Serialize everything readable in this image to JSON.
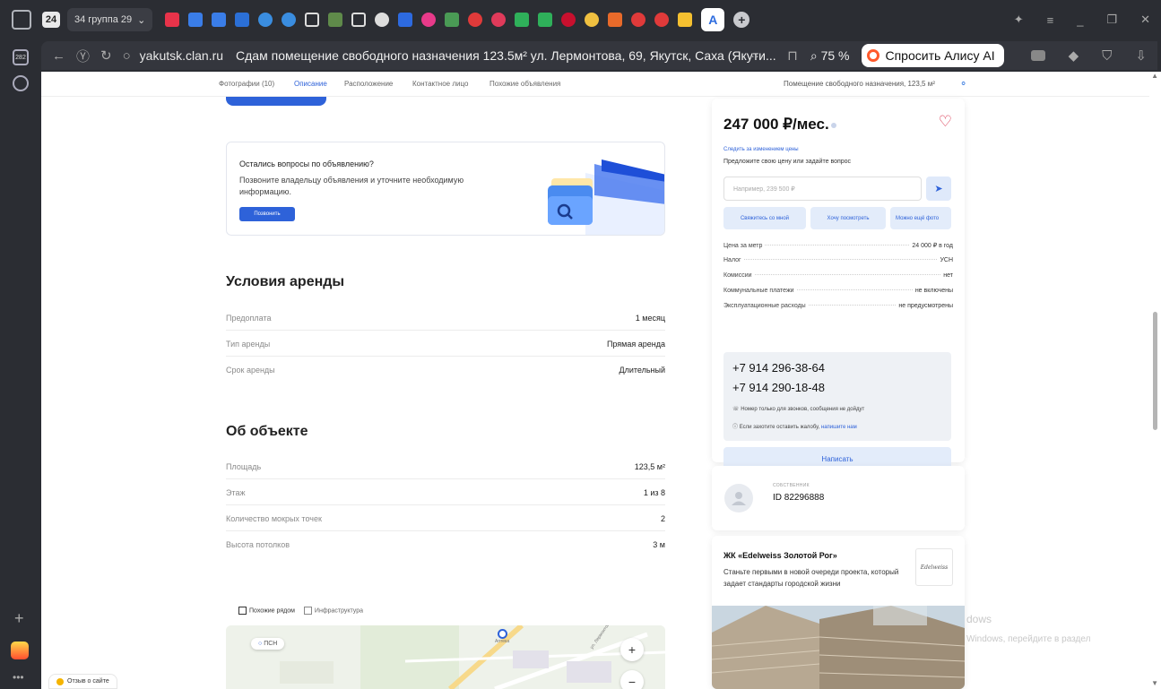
{
  "browser": {
    "tab_count": "24",
    "tab_group": "34 группа 29",
    "active_tab_letter": "A",
    "url": "yakutsk.clan.ru",
    "page_title": "Сдам помещение свободного назначения 123.5м² ул. Лермонтова, 69, Якутск, Саха (Якути...",
    "zoom": "75 %",
    "alice_label": "Спросить Алису AI",
    "side_badge": "282"
  },
  "nav": {
    "items": [
      "Фотографии (10)",
      "Описание",
      "Расположение",
      "Контактное лицо",
      "Похожие объявления"
    ],
    "active_index": 1,
    "right_title": "Помещение свободного назначения, 123,5 м²"
  },
  "question": {
    "title": "Остались вопросы по объявлению?",
    "text": "Позвоните владельцу объявления и уточните необходимую информацию.",
    "button": "Позвонить"
  },
  "rent_terms": {
    "heading": "Условия аренды",
    "rows": [
      {
        "label": "Предоплата",
        "value": "1 месяц"
      },
      {
        "label": "Тип аренды",
        "value": "Прямая аренда"
      },
      {
        "label": "Срок аренды",
        "value": "Длительный"
      }
    ]
  },
  "object": {
    "heading": "Об объекте",
    "rows": [
      {
        "label": "Площадь",
        "value": "123,5 м²"
      },
      {
        "label": "Этаж",
        "value": "1 из 8"
      },
      {
        "label": "Количество мокрых точек",
        "value": "2"
      },
      {
        "label": "Высота потолков",
        "value": "3 м"
      }
    ]
  },
  "map": {
    "tabs": [
      "Похожие рядом",
      "Инфраструктура"
    ],
    "pill": "ПСН",
    "poi_label": "Аптека",
    "street": "ул. Лермонтова",
    "zoom_in": "+",
    "zoom_out": "−"
  },
  "feedback": "Отзыв о сайте",
  "price_card": {
    "price": "247 000 ₽/мес.",
    "watch_link": "Следить за изменением цены",
    "offer_text": "Предложите свою цену или задайте вопрос",
    "offer_placeholder": "Например, 239 500 ₽",
    "chips": [
      "Свяжитесь со мной",
      "Хочу посмотреть",
      "Можно ещё фото"
    ],
    "specs": [
      {
        "label": "Цена за метр",
        "value": "24 000 ₽ в год"
      },
      {
        "label": "Налог",
        "value": "УСН"
      },
      {
        "label": "Комиссии",
        "value": "нет"
      },
      {
        "label": "Коммунальные платежи",
        "value": "не включены"
      },
      {
        "label": "Эксплуатационные расходы",
        "value": "не предусмотрены"
      }
    ],
    "phones": [
      "+7 914 296-38-64",
      "+7 914 290-18-48"
    ],
    "note_calls": "Номер только для звонков, сообщения не дойдут",
    "note_complaint": "Если захотите оставить жалобу,",
    "note_link": "напишите нам",
    "write_button": "Написать"
  },
  "owner": {
    "role": "СОБСТВЕННИК",
    "id": "ID 82296888"
  },
  "ad": {
    "title": "ЖК «Edelweiss Золотой Рог»",
    "text": "Станьте первыми в новой очереди проекта, который задает стандарты городской жизни",
    "logo": "Edelweiss"
  },
  "watermark": {
    "line1": "dows",
    "line2": "Windows, перейдите в раздел"
  }
}
